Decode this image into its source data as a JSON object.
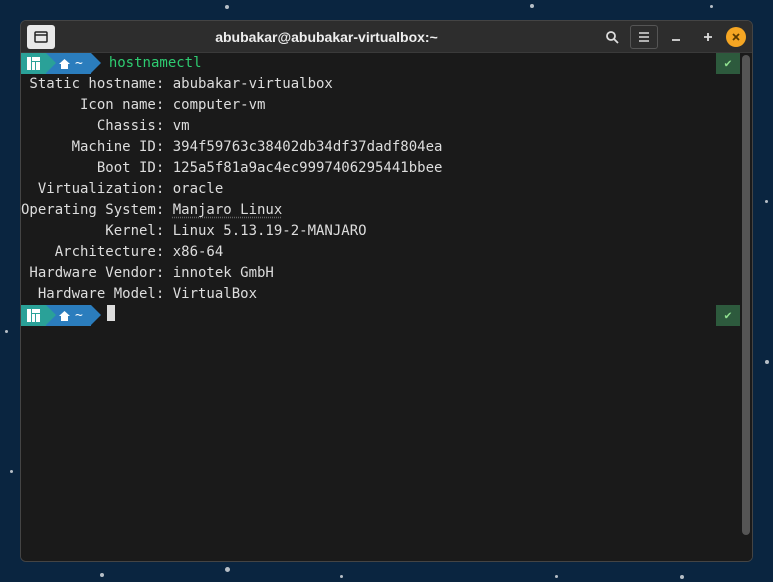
{
  "window": {
    "title": "abubakar@abubakar-virtualbox:~"
  },
  "prompt": {
    "home_label": "~",
    "command": "hostnamectl",
    "status_ok": "✔"
  },
  "output": {
    "rows": [
      {
        "label": " Static hostname:",
        "value": "abubakar-virtualbox"
      },
      {
        "label": "       Icon name:",
        "value": "computer-vm"
      },
      {
        "label": "         Chassis:",
        "value": "vm"
      },
      {
        "label": "      Machine ID:",
        "value": "394f59763c38402db34df37dadf804ea"
      },
      {
        "label": "         Boot ID:",
        "value": "125a5f81a9ac4ec9997406295441bbee"
      },
      {
        "label": "  Virtualization:",
        "value": "oracle"
      },
      {
        "label": "Operating System:",
        "value": "Manjaro Linux",
        "underline": true
      },
      {
        "label": "          Kernel:",
        "value": "Linux 5.13.19-2-MANJARO"
      },
      {
        "label": "    Architecture:",
        "value": "x86-64"
      },
      {
        "label": " Hardware Vendor:",
        "value": "innotek GmbH"
      },
      {
        "label": "  Hardware Model:",
        "value": "VirtualBox"
      }
    ]
  }
}
